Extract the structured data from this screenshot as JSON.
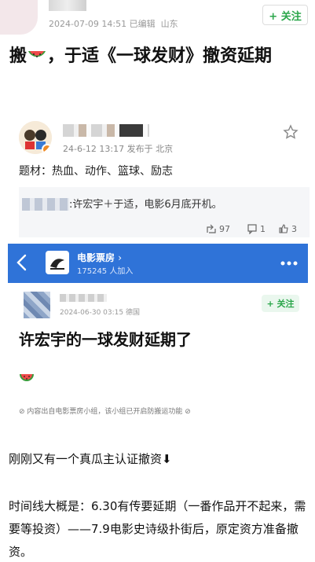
{
  "post": {
    "timestamp": "2024-07-09 14:51",
    "edited": "已编辑",
    "location": "山东",
    "follow_label": "+ 关注",
    "title_prefix": "搬",
    "title_rest": "，于适《一球发财》撤资延期"
  },
  "embedded_card": {
    "meta": "24-6-12 13:17  发布于 北京",
    "topics": "题材：热血、动作、篮球、励志",
    "repost_text": ":许宏宇＋于适，电影6月底开机。",
    "stats": {
      "shares": "97",
      "comments": "1",
      "likes": "3"
    }
  },
  "group_header": {
    "name": "电影票房",
    "members": "175245 人加入"
  },
  "group_post": {
    "meta": "2024-06-30 03:15  德国",
    "follow_label": "+ 关注",
    "title": "许宏宇的一球发财延期了",
    "source_note": "⊘ 内容出自电影票房小组，该小组已开启防搬运功能 ⊘"
  },
  "body": {
    "line1": "刚刚又有一个真瓜主认证撤资⬇",
    "paragraph": "时间线大概是：6.30有传要延期（一番作品开不起来，需要等投资）——7.9电影史诗级扑街后，原定资方准备撤资。"
  },
  "colors": {
    "accent_green": "#2aa64a",
    "header_blue": "#2f73d8"
  },
  "icons": [
    "star-icon",
    "share-icon",
    "comment-icon",
    "like-icon",
    "back-icon",
    "more-icon",
    "watermelon-icon"
  ]
}
